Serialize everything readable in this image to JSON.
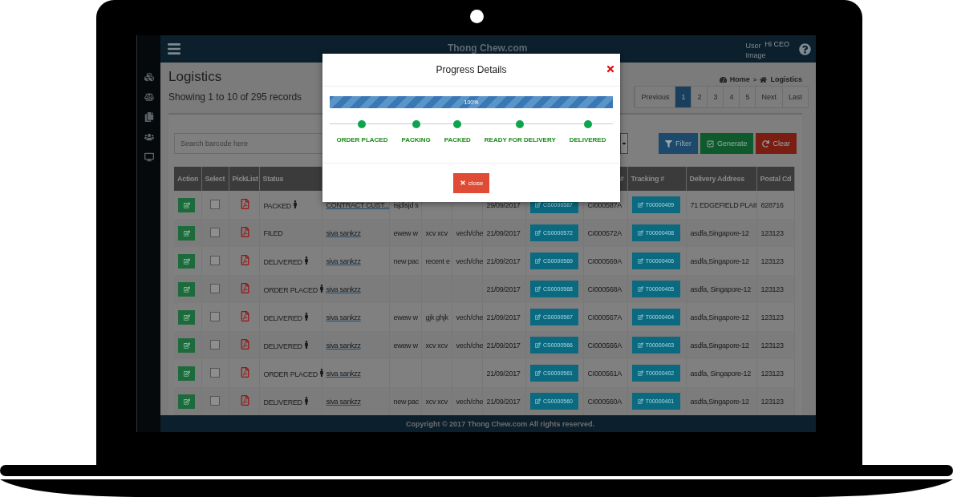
{
  "header": {
    "brand": "Thong Chew.com",
    "user_image_alt": "User Image",
    "greeting": "Hi CEO"
  },
  "page": {
    "title": "Logistics",
    "summary": "Showing 1 to 10 of 295 records",
    "breadcrumb_separator": ">",
    "breadcrumbs": [
      {
        "label": "Home",
        "kind": "dashboard"
      },
      {
        "label": "Logistics",
        "kind": "home"
      }
    ]
  },
  "pagination": [
    {
      "label": "Previous",
      "selected": false
    },
    {
      "label": "1",
      "selected": true
    },
    {
      "label": "2",
      "selected": false
    },
    {
      "label": "3",
      "selected": false
    },
    {
      "label": "4",
      "selected": false
    },
    {
      "label": "5",
      "selected": false
    },
    {
      "label": "Next",
      "selected": false
    },
    {
      "label": "Last",
      "selected": false
    }
  ],
  "search": {
    "placeholder": "Search barcode here"
  },
  "buttons": [
    {
      "label": "Filter",
      "kind": "filter"
    },
    {
      "label": "Generate",
      "kind": "generate"
    },
    {
      "label": "Clear",
      "kind": "clear"
    }
  ],
  "table": {
    "columns": [
      "Action",
      "Select",
      "PickList",
      "Status",
      "",
      "",
      "",
      "",
      "",
      "",
      "#",
      "Tracking #",
      "Delivery Address",
      "Postal Cd"
    ],
    "rows": [
      {
        "checked": false,
        "status": "PACKED",
        "person": true,
        "customer": "CONTRACT CUST...",
        "column_6": "isjdisjd s",
        "column_7": "",
        "column_8": "",
        "date": "29/09/2017",
        "cs": "CS0000587",
        "ci": "CI000587A",
        "tracking": "T00000409",
        "address": "71 EDGEFIELD PLAII",
        "postal": "828716"
      },
      {
        "checked": false,
        "status": "FILED",
        "person": false,
        "customer": "siva sankzz",
        "column_6": "ewew w",
        "column_7": "xcv xcv",
        "column_8": "vech/che",
        "date": "21/09/2017",
        "cs": "CS0000572",
        "ci": "CI000572A",
        "tracking": "T00000408",
        "address": "asdfa,Singapore-12",
        "postal": "123123"
      },
      {
        "checked": false,
        "status": "DELIVERED",
        "person": true,
        "customer": "siva sankzz",
        "column_6": "new pac",
        "column_7": "recent e",
        "column_8": "vech/che",
        "date": "21/09/2017",
        "cs": "CS0000569",
        "ci": "CI000569A",
        "tracking": "T00000406",
        "address": "asdfa,Singapore-12",
        "postal": "123123"
      },
      {
        "checked": false,
        "status": "ORDER PLACED",
        "person": true,
        "customer": "siva sankzz",
        "column_6": "",
        "column_7": "",
        "column_8": "",
        "date": "21/09/2017",
        "cs": "CS0000568",
        "ci": "CI000568A",
        "tracking": "T00000405",
        "address": "asdfa, Singapore-12",
        "postal": "123123"
      },
      {
        "checked": false,
        "status": "DELIVERED",
        "person": true,
        "customer": "siva sankzz",
        "column_6": "ewew w",
        "column_7": "gjk ghjk",
        "column_8": "vech/che",
        "date": "21/09/2017",
        "cs": "CS0000567",
        "ci": "CI000567A",
        "tracking": "T00000404",
        "address": "asdfa,Singapore-12",
        "postal": "123123"
      },
      {
        "checked": false,
        "status": "DELIVERED",
        "person": true,
        "customer": "siva sankzz",
        "column_6": "ewew w",
        "column_7": "xcv xcv",
        "column_8": "vech/che",
        "date": "21/09/2017",
        "cs": "CS0000566",
        "ci": "CI000566A",
        "tracking": "T00000403",
        "address": "asdfa,Singapore-12",
        "postal": "123123"
      },
      {
        "checked": false,
        "status": "ORDER PLACED",
        "person": true,
        "customer": "siva sankzz",
        "column_6": "",
        "column_7": "",
        "column_8": "",
        "date": "21/09/2017",
        "cs": "CS0000561",
        "ci": "CI000561A",
        "tracking": "T00000402",
        "address": "asdfa, Singapore-12",
        "postal": "123123"
      },
      {
        "checked": false,
        "status": "DELIVERED",
        "person": true,
        "customer": "siva sankzz",
        "column_6": "new pac",
        "column_7": "xcv xcv",
        "column_8": "vech/che",
        "date": "21/09/2017",
        "cs": "CS0000560",
        "ci": "CI000560A",
        "tracking": "T00000401",
        "address": "asdfa,Singapore-12",
        "postal": "123123"
      }
    ]
  },
  "footer": "Copyright © 2017 Thong Chew.com All rights reserved.",
  "modal": {
    "title": "Progress Details",
    "progress": {
      "level": 1,
      "reading": "100%"
    },
    "steps": [
      {
        "label": "ORDER PLACED",
        "done": true
      },
      {
        "label": "PACKING",
        "done": true
      },
      {
        "label": "PACKED",
        "done": true
      },
      {
        "label": "READY FOR DELIVERY",
        "done": true
      },
      {
        "label": "DELIVERED",
        "done": true
      }
    ],
    "close_button": "close"
  }
}
